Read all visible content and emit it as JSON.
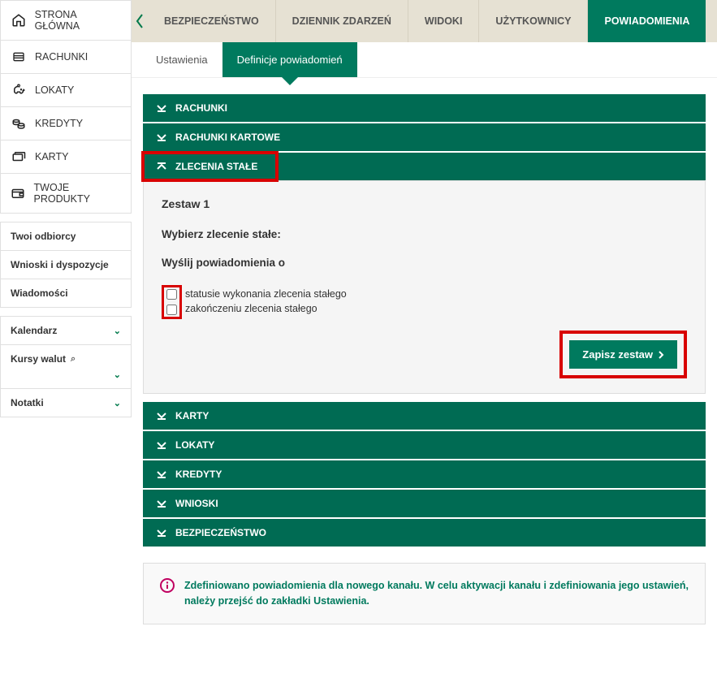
{
  "sidebar": {
    "main_items": [
      {
        "label": "STRONA GŁÓWNA",
        "icon": "home"
      },
      {
        "label": "RACHUNKI",
        "icon": "list"
      },
      {
        "label": "LOKATY",
        "icon": "piggy"
      },
      {
        "label": "KREDYTY",
        "icon": "coins"
      },
      {
        "label": "KARTY",
        "icon": "cards"
      },
      {
        "label": "TWOJE PRODUKTY",
        "icon": "wallet"
      }
    ],
    "secondary_items": [
      {
        "label": "Twoi odbiorcy"
      },
      {
        "label": "Wnioski i dyspozycje"
      },
      {
        "label": "Wiadomości"
      }
    ],
    "widgets": [
      {
        "label": "Kalendarz"
      },
      {
        "label": "Kursy walut"
      },
      {
        "label": "Notatki"
      }
    ]
  },
  "topnav": [
    {
      "label": "BEZPIECZEŃSTWO"
    },
    {
      "label": "DZIENNIK ZDARZEŃ"
    },
    {
      "label": "WIDOKI"
    },
    {
      "label": "UŻYTKOWNICY"
    },
    {
      "label": "POWIADOMIENIA",
      "active": true
    }
  ],
  "subnav": [
    {
      "label": "Ustawienia"
    },
    {
      "label": "Definicje powiadomień",
      "active": true
    }
  ],
  "accordions_top": [
    {
      "label": "RACHUNKI"
    },
    {
      "label": "RACHUNKI KARTOWE"
    }
  ],
  "panel": {
    "header": "ZLECENIA STAŁE",
    "title": "Zestaw 1",
    "step1": "Wybierz zlecenie stałe:",
    "step2": "Wyślij powiadomienia o",
    "checks": [
      "statusie wykonania zlecenia stałego",
      "zakończeniu zlecenia stałego"
    ],
    "save_button": "Zapisz zestaw"
  },
  "accordions_bottom": [
    {
      "label": "KARTY"
    },
    {
      "label": "LOKATY"
    },
    {
      "label": "KREDYTY"
    },
    {
      "label": "WNIOSKI"
    },
    {
      "label": "BEZPIECZEŃSTWO"
    }
  ],
  "info_message": "Zdefiniowano powiadomienia dla nowego kanału. W celu aktywacji kanału i zdefiniowania jego ustawień, należy przejść do zakładki Ustawienia."
}
